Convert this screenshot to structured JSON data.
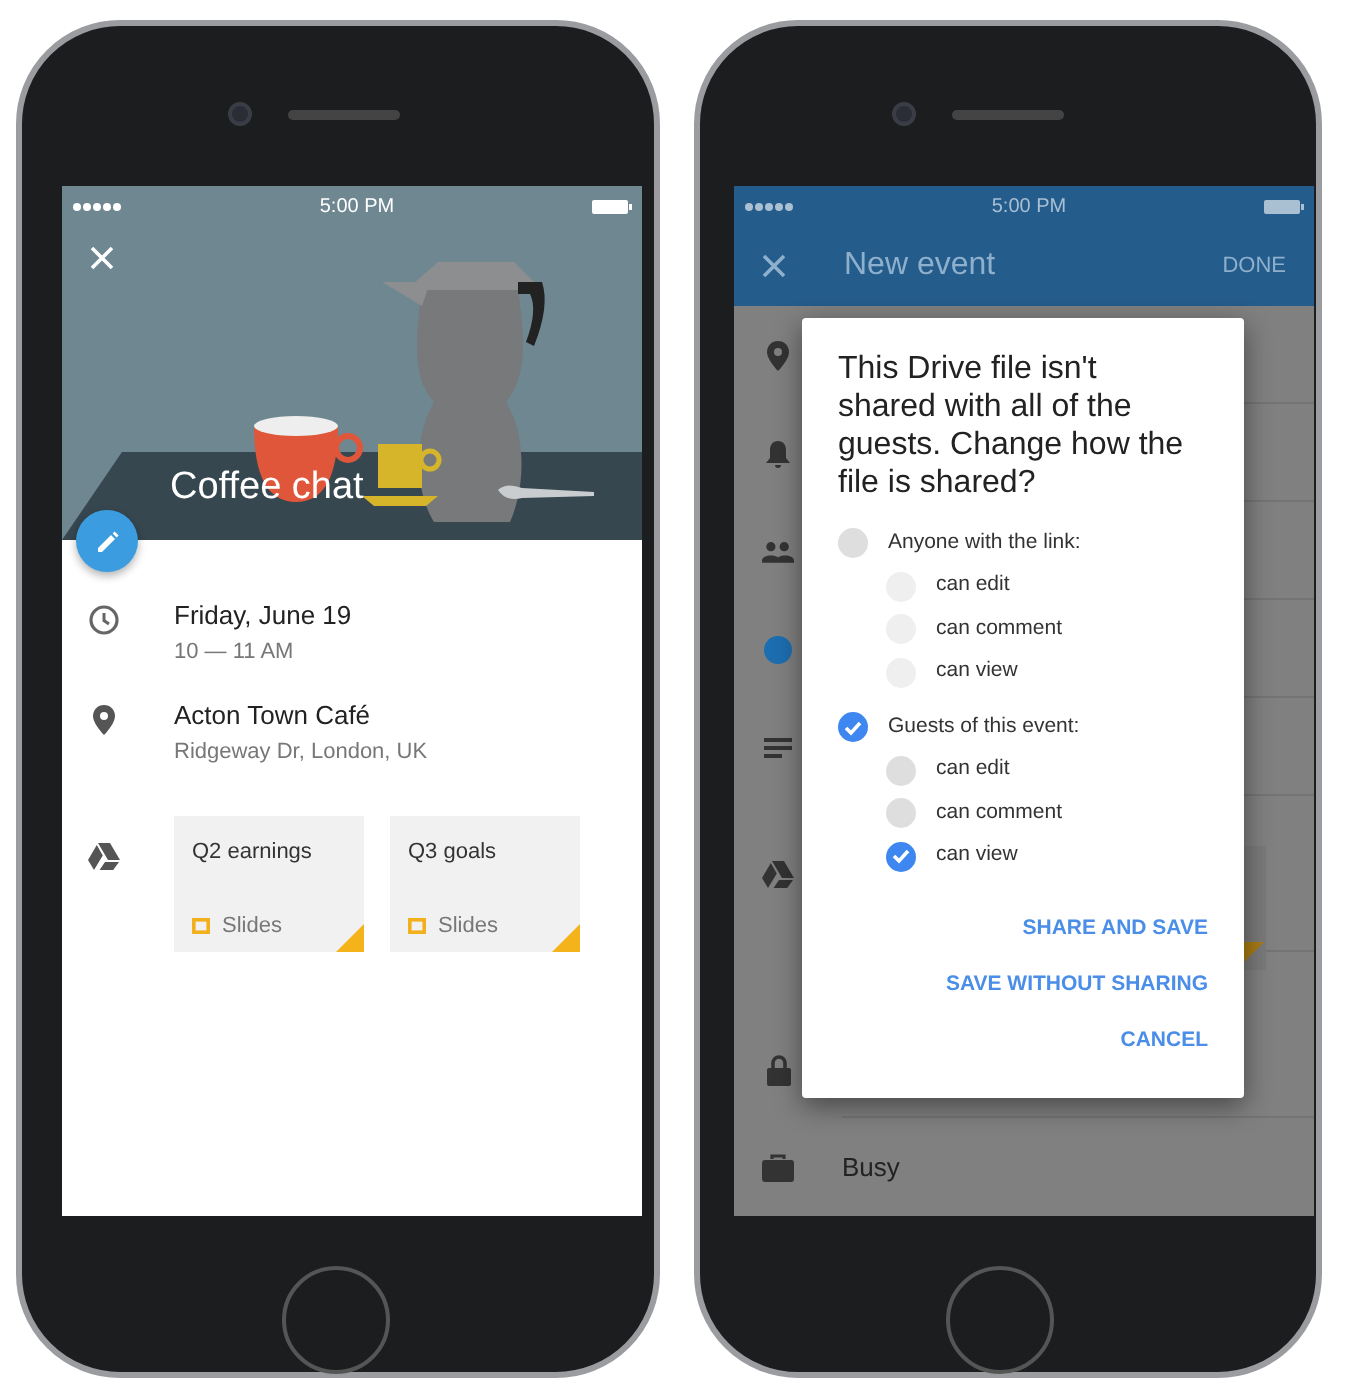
{
  "left_phone": {
    "status_time": "5:00 PM",
    "event": {
      "title": "Coffee chat",
      "date": "Friday, June 19",
      "time": "10 — 11 AM",
      "place": "Acton Town Café",
      "address": "Ridgeway Dr, London, UK",
      "attachments": [
        {
          "name": "Q2 earnings",
          "type": "Slides"
        },
        {
          "name": "Q3 goals",
          "type": "Slides"
        }
      ]
    }
  },
  "right_phone": {
    "status_time": "5:00 PM",
    "app_bar": {
      "title": "New event",
      "action": "DONE"
    },
    "availability": "Busy",
    "dialog": {
      "message": "This Drive file isn't shared with all of the guests. Change how the file is shared?",
      "options": [
        {
          "label": "Anyone with the link:",
          "selected": false,
          "permissions": [
            {
              "label": "can edit",
              "selected": false,
              "disabled": true
            },
            {
              "label": "can comment",
              "selected": false,
              "disabled": true
            },
            {
              "label": "can view",
              "selected": false,
              "disabled": true
            }
          ]
        },
        {
          "label": "Guests of this event:",
          "selected": true,
          "permissions": [
            {
              "label": "can edit",
              "selected": false,
              "disabled": false
            },
            {
              "label": "can comment",
              "selected": false,
              "disabled": false
            },
            {
              "label": "can view",
              "selected": true,
              "disabled": false
            }
          ]
        }
      ],
      "actions": [
        "SHARE AND SAVE",
        "SAVE WITHOUT SHARING",
        "CANCEL"
      ]
    }
  }
}
